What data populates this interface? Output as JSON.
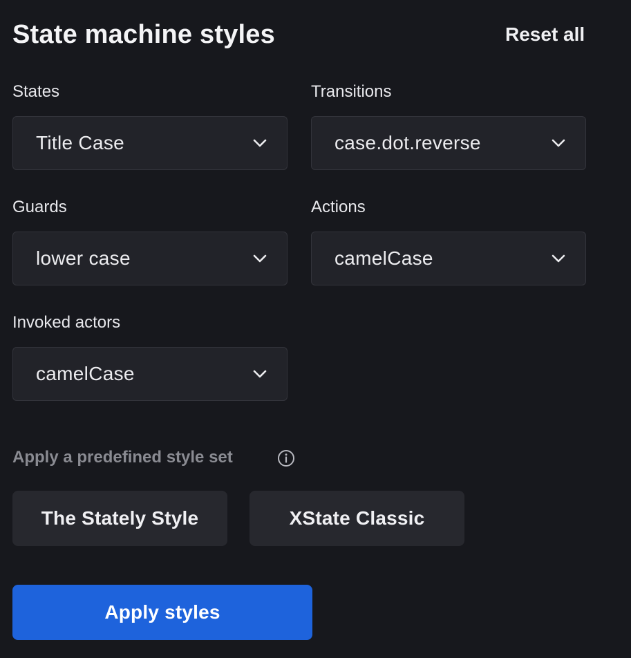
{
  "header": {
    "title": "State machine styles",
    "reset_label": "Reset all"
  },
  "fields": {
    "states": {
      "label": "States",
      "value": "Title Case"
    },
    "transitions": {
      "label": "Transitions",
      "value": "case.dot.reverse"
    },
    "guards": {
      "label": "Guards",
      "value": "lower case"
    },
    "actions": {
      "label": "Actions",
      "value": "camelCase"
    },
    "invoked_actors": {
      "label": "Invoked actors",
      "value": "camelCase"
    }
  },
  "presets": {
    "label": "Apply a predefined style set",
    "info_icon": "info-icon",
    "stately_label": "The Stately Style",
    "xstate_label": "XState Classic"
  },
  "apply": {
    "label": "Apply styles"
  },
  "colors": {
    "background": "#17181d",
    "select_bg": "#222329",
    "preset_bg": "#27282e",
    "primary": "#1e63dc",
    "muted_text": "#8a8b92"
  }
}
